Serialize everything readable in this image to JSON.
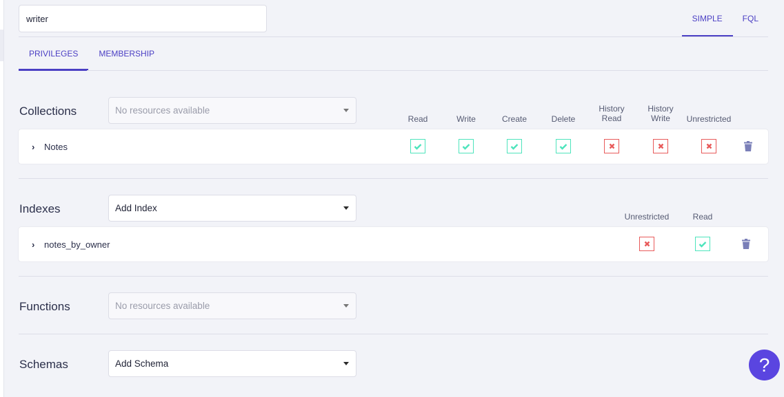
{
  "role": {
    "name": "writer"
  },
  "mode_tabs": [
    {
      "label": "SIMPLE",
      "active": true
    },
    {
      "label": "FQL",
      "active": false
    }
  ],
  "sub_tabs": [
    {
      "label": "PRIVILEGES",
      "active": true
    },
    {
      "label": "MEMBERSHIP",
      "active": false
    }
  ],
  "collections": {
    "label": "Collections",
    "select_placeholder": "No resources available",
    "columns": [
      "Read",
      "Write",
      "Create",
      "Delete",
      "History Read",
      "History Write",
      "Unrestricted"
    ],
    "column_lines": [
      [
        "Read"
      ],
      [
        "Write"
      ],
      [
        "Create"
      ],
      [
        "Delete"
      ],
      [
        "History",
        "Read"
      ],
      [
        "History",
        "Write"
      ],
      [
        "Unrestricted"
      ]
    ],
    "rows": [
      {
        "name": "Notes",
        "permissions": [
          true,
          true,
          true,
          true,
          false,
          false,
          false
        ]
      }
    ]
  },
  "indexes": {
    "label": "Indexes",
    "select_value": "Add Index",
    "columns": [
      "Unrestricted",
      "Read"
    ],
    "rows": [
      {
        "name": "notes_by_owner",
        "permissions": [
          false,
          true
        ]
      }
    ]
  },
  "functions": {
    "label": "Functions",
    "select_placeholder": "No resources available"
  },
  "schemas": {
    "label": "Schemas",
    "select_value": "Add Schema"
  },
  "help": {
    "label": "?"
  },
  "colors": {
    "accent": "#4b3fc4",
    "check_on": "#4de4bc",
    "check_off": "#e85a5a",
    "trash": "#7a7fb8",
    "help_bg": "#5a45e0"
  }
}
